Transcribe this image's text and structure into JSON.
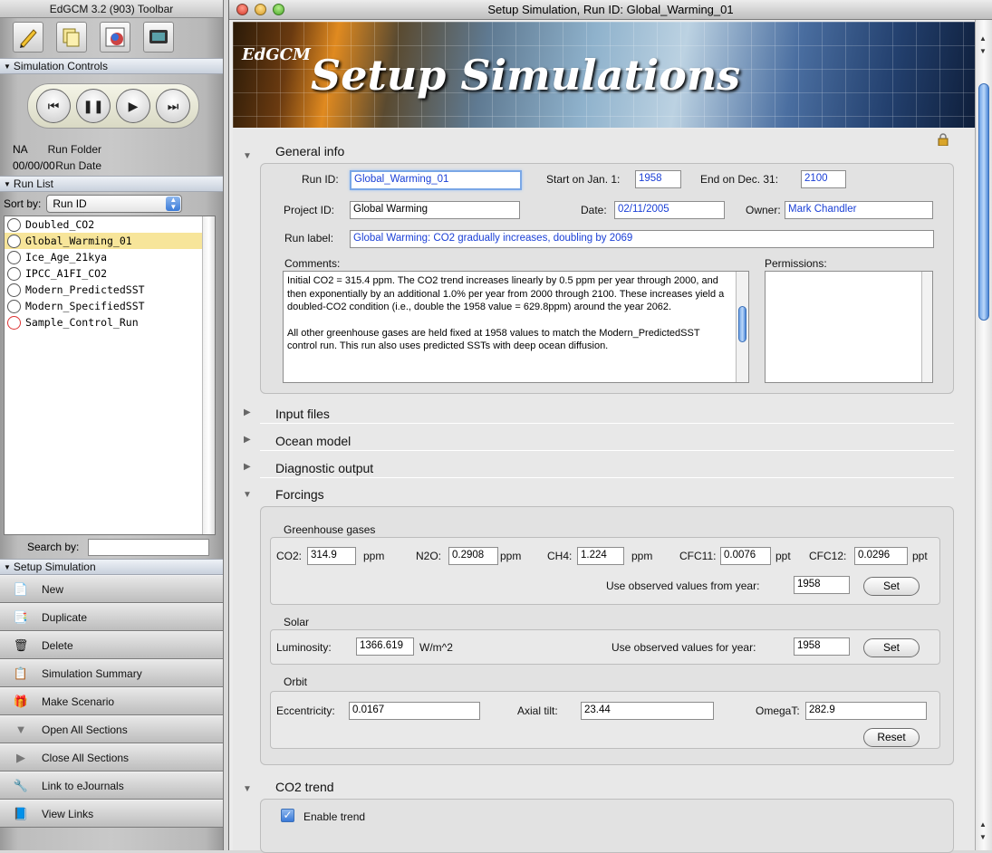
{
  "toolbar": {
    "title": "EdGCM 3.2 (903) Toolbar",
    "icons": [
      "pencil-icon",
      "documents-icon",
      "data-table-icon",
      "monitor-icon"
    ],
    "simulation_controls_label": "Simulation Controls",
    "run_folder_label": "Run Folder",
    "run_folder_value": "NA",
    "run_date_label": "Run Date",
    "run_date_value": "00/00/00",
    "run_list_label": "Run List",
    "sort_by_label": "Sort by:",
    "sort_by_value": "Run ID",
    "runs": [
      {
        "name": "Doubled_CO2"
      },
      {
        "name": "Global_Warming_01"
      },
      {
        "name": "Ice_Age_21kya"
      },
      {
        "name": "IPCC_A1FI_CO2"
      },
      {
        "name": "Modern_PredictedSST"
      },
      {
        "name": "Modern_SpecifiedSST"
      },
      {
        "name": "Sample_Control_Run"
      }
    ],
    "search_by_label": "Search by:",
    "setup_simulation_label": "Setup Simulation",
    "actions": [
      "New",
      "Duplicate",
      "Delete",
      "Simulation Summary",
      "Make Scenario",
      "Open All Sections",
      "Close All Sections",
      "Link to eJournals",
      "View Links"
    ]
  },
  "window": {
    "title": "Setup Simulation, Run ID: Global_Warming_01",
    "banner_small": "EdGCM",
    "banner_big": "Setup Simulations"
  },
  "general": {
    "title": "General info",
    "run_id_label": "Run ID:",
    "run_id": "Global_Warming_01",
    "start_label": "Start on Jan. 1:",
    "start": "1958",
    "end_label": "End on Dec. 31:",
    "end": "2100",
    "project_id_label": "Project ID:",
    "project_id": "Global Warming",
    "date_label": "Date:",
    "date": "02/11/2005",
    "owner_label": "Owner:",
    "owner": "Mark Chandler",
    "run_label_label": "Run label:",
    "run_label": "Global Warming: CO2 gradually increases, doubling by 2069",
    "comments_label": "Comments:",
    "comments_p1": "Initial CO2 = 315.4 ppm. The CO2 trend increases linearly by 0.5 ppm per year through 2000, and then exponentially by an additional 1.0% per year from 2000 through 2100. These increases yield a doubled-CO2 condition (i.e., double the 1958 value = 629.8ppm) around the year 2062.",
    "comments_p2": "All other greenhouse gases are held fixed at 1958 values to match the Modern_PredictedSST control run. This run also uses predicted SSTs with deep ocean diffusion.",
    "permissions_label": "Permissions:"
  },
  "sections": {
    "input_files": "Input files",
    "ocean_model": "Ocean model",
    "diagnostic_output": "Diagnostic output",
    "forcings": "Forcings",
    "co2_trend": "CO2 trend"
  },
  "forcings": {
    "ghg_title": "Greenhouse gases",
    "co2_label": "CO2:",
    "co2": "314.9",
    "co2_unit": "ppm",
    "n2o_label": "N2O:",
    "n2o": "0.2908",
    "n2o_unit": "ppm",
    "ch4_label": "CH4:",
    "ch4": "1.224",
    "ch4_unit": "ppm",
    "cfc11_label": "CFC11:",
    "cfc11": "0.0076",
    "cfc11_unit": "ppt",
    "cfc12_label": "CFC12:",
    "cfc12": "0.0296",
    "cfc12_unit": "ppt",
    "ghg_observed_label": "Use observed values from year:",
    "ghg_year": "1958",
    "set_label": "Set",
    "solar_title": "Solar",
    "luminosity_label": "Luminosity:",
    "luminosity": "1366.619",
    "luminosity_unit": "W/m^2",
    "solar_observed_label": "Use observed values for year:",
    "solar_year": "1958",
    "orbit_title": "Orbit",
    "ecc_label": "Eccentricity:",
    "ecc": "0.0167",
    "tilt_label": "Axial tilt:",
    "tilt": "23.44",
    "omega_label": "OmegaT:",
    "omega": "282.9",
    "reset_label": "Reset"
  },
  "co2trend": {
    "enable_label": "Enable trend",
    "enabled": true
  }
}
